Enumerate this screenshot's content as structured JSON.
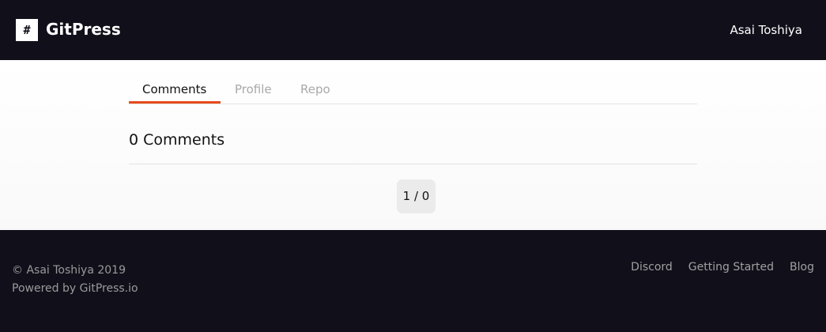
{
  "header": {
    "logo_glyph": "#",
    "brand": "GitPress",
    "user_name": "Asai Toshiya"
  },
  "tabs": [
    {
      "label": "Comments",
      "active": true
    },
    {
      "label": "Profile",
      "active": false
    },
    {
      "label": "Repo",
      "active": false
    }
  ],
  "comments": {
    "count_label": "0 Comments"
  },
  "pagination": {
    "label": "1 / 0"
  },
  "footer": {
    "copyright": "© Asai Toshiya 2019",
    "powered_by": "Powered by GitPress.io",
    "links": [
      "Discord",
      "Getting Started",
      "Blog"
    ]
  },
  "colors": {
    "dark_background": "#110f1a",
    "accent": "#e64b1c"
  }
}
